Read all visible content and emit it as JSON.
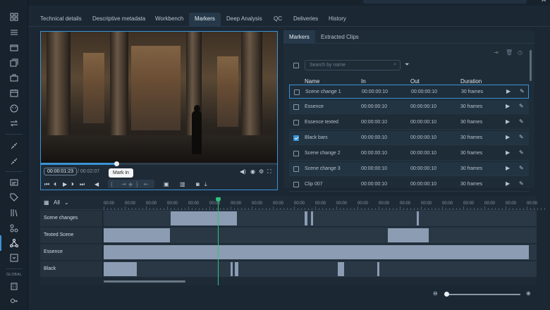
{
  "tabs": [
    {
      "label": "Technical details"
    },
    {
      "label": "Descriptive metadata"
    },
    {
      "label": "Workbench"
    },
    {
      "label": "Markers",
      "active": true
    },
    {
      "label": "Deep Analysis"
    },
    {
      "label": "QC"
    },
    {
      "label": "Deliveries"
    },
    {
      "label": "History"
    }
  ],
  "player": {
    "current_timecode": "00:00:01:23",
    "total_timecode": "/ 00:02:07",
    "tooltip": "Mark in",
    "progress": 0.32
  },
  "right_panel": {
    "tabs": [
      {
        "label": "Markers",
        "active": true
      },
      {
        "label": "Extracted Clips"
      }
    ],
    "search_placeholder": "Search by name",
    "columns": {
      "name": "Name",
      "in": "In",
      "out": "Out",
      "duration": "Duration"
    },
    "rows": [
      {
        "name": "Scene change 1",
        "in": "00:00:00:10",
        "out": "00:00:00:10",
        "duration": "30 frames",
        "checked": false,
        "selected": true
      },
      {
        "name": "Essence",
        "in": "00:00:00:10",
        "out": "00:00:00:10",
        "duration": "30 frames",
        "checked": false
      },
      {
        "name": "Essence texted",
        "in": "00:00:00:10",
        "out": "00:00:00:10",
        "duration": "30 frames",
        "checked": false
      },
      {
        "name": "Black bars",
        "in": "00:00:00:10",
        "out": "00:00:00:10",
        "duration": "30 frames",
        "checked": true
      },
      {
        "name": "Scene change 2",
        "in": "00:00:00:10",
        "out": "00:00:00:10",
        "duration": "30 frames",
        "checked": false
      },
      {
        "name": "Scene change 3",
        "in": "00:00:00:10",
        "out": "00:00:00:10",
        "duration": "30 frames",
        "checked": false
      },
      {
        "name": "Clip 007",
        "in": "00:00:00:10",
        "out": "00:00:00:10",
        "duration": "30 frames",
        "checked": false
      }
    ]
  },
  "timeline": {
    "filter_label": "All",
    "ruler_label": "00:00",
    "tracks": [
      {
        "name": "Scene changes"
      },
      {
        "name": "Texted Scene"
      },
      {
        "name": "Essence"
      },
      {
        "name": "Black"
      }
    ]
  },
  "rail": {
    "global_label": "GLOBAL"
  },
  "colors": {
    "accent": "#3b93d6",
    "playhead": "#2ec27e",
    "clip": "#8c9cb3"
  }
}
